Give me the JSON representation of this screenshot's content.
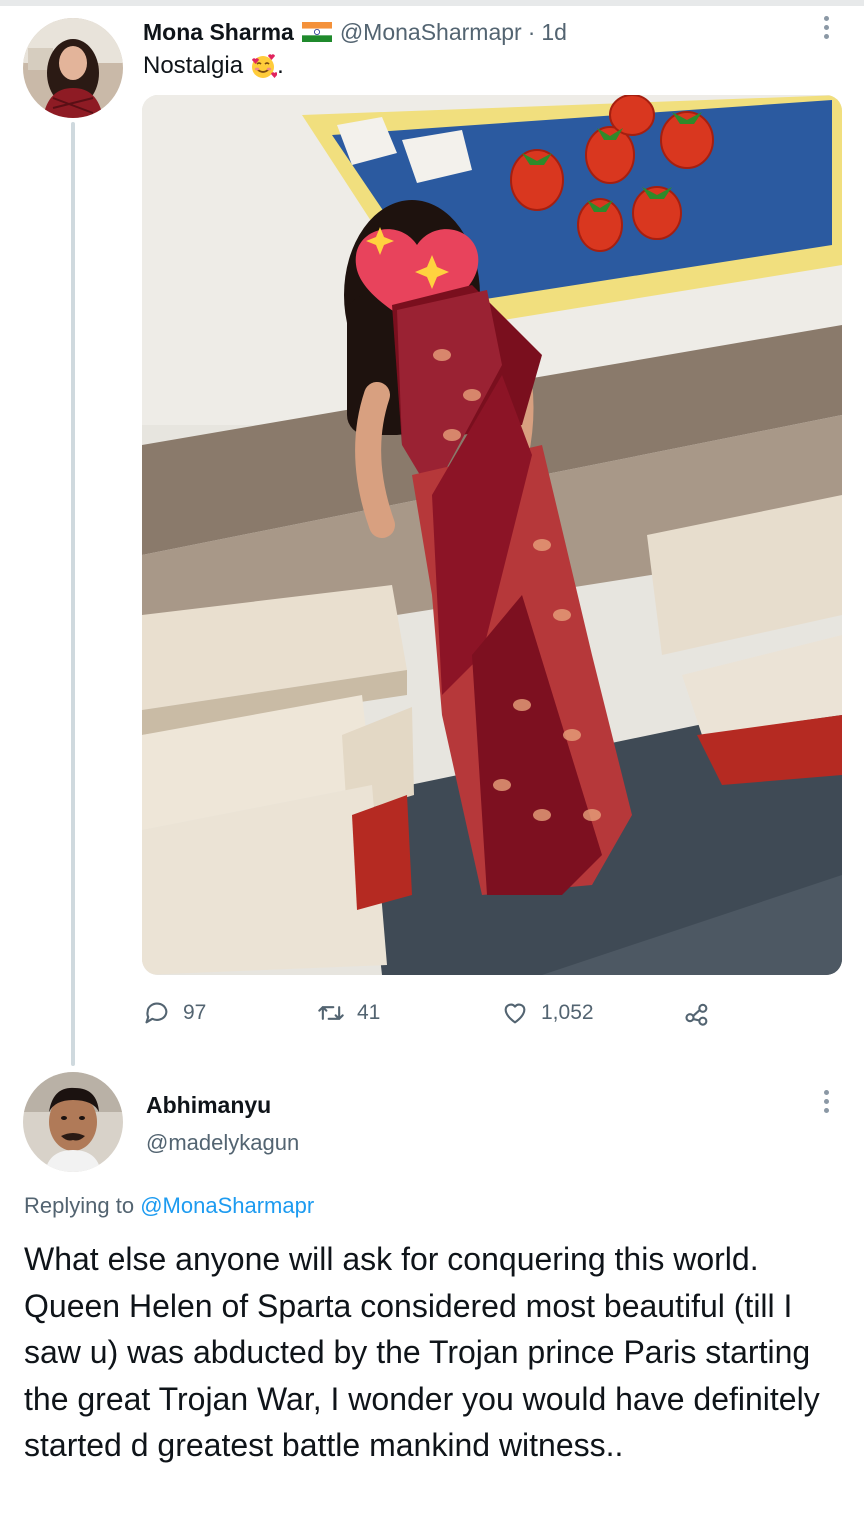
{
  "tweet": {
    "display_name": "Mona Sharma",
    "flag_icon": "india-flag-icon",
    "handle": "@MonaSharmapr",
    "separator": "·",
    "time": "1d",
    "text": "Nostalgia",
    "text_suffix": ".",
    "emoji_icon": "smiling-face-with-hearts-icon",
    "photo_description_icon": "photo-woman-in-saree-classroom",
    "actions": {
      "reply_count": "97",
      "retweet_count": "41",
      "like_count": "1,052"
    }
  },
  "reply": {
    "display_name": "Abhimanyu",
    "handle": "@madelykagun",
    "replying_prefix": "Replying to",
    "replying_to": "@MonaSharmapr",
    "text": "What else anyone will ask for  conquering this world. Queen Helen of Sparta considered most beautiful (till I saw u) was abducted  by the Trojan prince Paris starting the great Trojan War, I wonder you would have definitely started d greatest battle mankind witness.."
  },
  "colors": {
    "text_primary": "#0f1419",
    "text_secondary": "#536471",
    "link": "#1d9bf0",
    "thread_line": "#cfd9de"
  }
}
